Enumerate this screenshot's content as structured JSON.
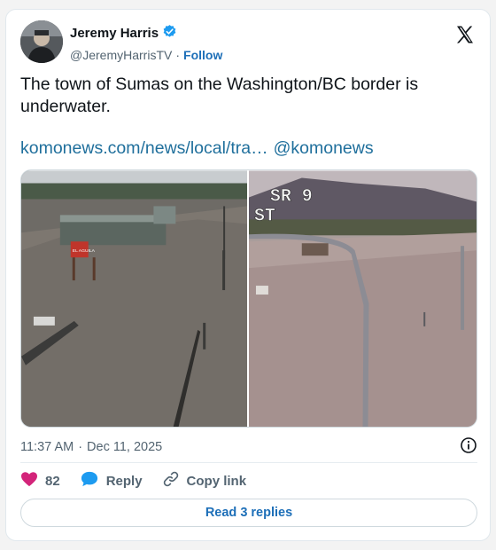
{
  "author": {
    "name": "Jeremy Harris",
    "handle": "@JeremyHarrisTV",
    "separator": "·",
    "follow_label": "Follow",
    "verified_color": "#1d9bf0"
  },
  "tweet": {
    "text": "The town of Sumas on the Washington/BC border is underwater.",
    "link_text": "komonews.com/news/local/tra…",
    "mention": "@komonews",
    "link_color": "#1f6f9c"
  },
  "media": {
    "right_overlay_line1": "SR 9",
    "right_overlay_line2": "ST",
    "left_sign_text": "EL AGUILA"
  },
  "meta": {
    "time": "11:37 AM",
    "separator": "·",
    "date": "Dec 11, 2025"
  },
  "actions": {
    "like_count": "82",
    "like_color": "#d3247a",
    "reply_label": "Reply",
    "copy_label": "Copy link"
  },
  "replies_button": "Read 3 replies",
  "icons": [
    "verified-badge-icon",
    "x-logo-icon",
    "heart-icon",
    "reply-bubble-icon",
    "link-icon",
    "info-icon"
  ]
}
